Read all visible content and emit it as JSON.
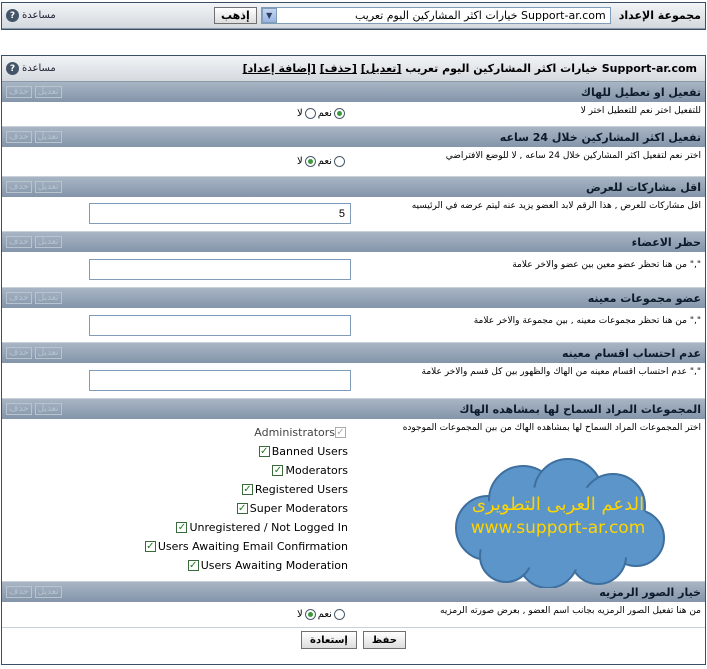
{
  "top": {
    "help_label": "مساعدة",
    "group_label": "مجموعة الإعداد",
    "select_value": "خيارات اكثر المشاركين اليوم تعريب Support-ar.com",
    "go_label": "إذهب"
  },
  "header": {
    "help_label": "مساعدة",
    "title": "خيارات اكثر المشاركين اليوم تعريب Support-ar.com",
    "edit_link": "[تعديل]",
    "delete_link": "[حذف]",
    "add_link": "[إضافة إعداد]"
  },
  "sections": [
    {
      "title": "تفعيل او تعطيل للهاك",
      "desc": "للتفعيل اختر نعم للتعطيل اختر لا",
      "yes": "نعم",
      "no": "لا",
      "selected": "yes",
      "edit": "تعديل",
      "del": "حذف"
    },
    {
      "title": "تفعيل اكثر المشاركين خلال 24 ساعه",
      "desc": "اختر نعم لتفعيل اكثر المشاركين خلال 24 ساعه , لا للوضع الافتراضي",
      "yes": "نعم",
      "no": "لا",
      "selected": "no",
      "edit": "تعديل",
      "del": "حذف"
    },
    {
      "title": "اقل مشاركات للعرض",
      "desc": "اقل مشاركات للعرض , هذا الرقم لابد العضو يزيد عنه ليتم عرضه في الرئيسيه",
      "value": "5",
      "edit": "تعديل",
      "del": "حذف"
    },
    {
      "title": "حظر الاعضاء",
      "desc": "من هنا تحظر عضو معين بين عضو والاخر علامة \",\"",
      "value": "",
      "edit": "تعديل",
      "del": "حذف"
    },
    {
      "title": "عضو مجموعات معينه",
      "desc": "من هنا تحظر مجموعات معينه , بين مجموعة والاخر علامة \",\"",
      "value": "",
      "edit": "تعديل",
      "del": "حذف"
    },
    {
      "title": "عدم احتساب اقسام معينه",
      "desc": "عدم احتساب اقسام معينه من الهاك والظهور بين كل قسم والاخر علامة \",\"",
      "value": "",
      "edit": "تعديل",
      "del": "حذف"
    },
    {
      "title": "المجموعات المراد السماح لها بمشاهده الهاك",
      "desc": "اختر المجموعات المراد السماح لها بمشاهده الهاك من بين المجموعات الموجوده",
      "edit": "تعديل",
      "del": "حذف",
      "groups": [
        "Administrators",
        "Banned Users",
        "Moderators",
        "Registered Users",
        "Super Moderators",
        "Unregistered / Not Logged In",
        "Users Awaiting Email Confirmation",
        "Users Awaiting Moderation"
      ]
    },
    {
      "title": "خيار الصور الرمزيه",
      "desc": "من هنا تفعيل الصور الرمزيه بجانب اسم العضو , بعرض صورته الرمزيه",
      "yes": "نعم",
      "no": "لا",
      "selected": "no",
      "edit": "تعديل",
      "del": "حذف"
    }
  ],
  "footer": {
    "save_label": "حفظ",
    "reset_label": "إستعادة"
  },
  "watermark": {
    "line1": "الدعم العربى التطويرى",
    "line2": "www.support-ar.com"
  }
}
